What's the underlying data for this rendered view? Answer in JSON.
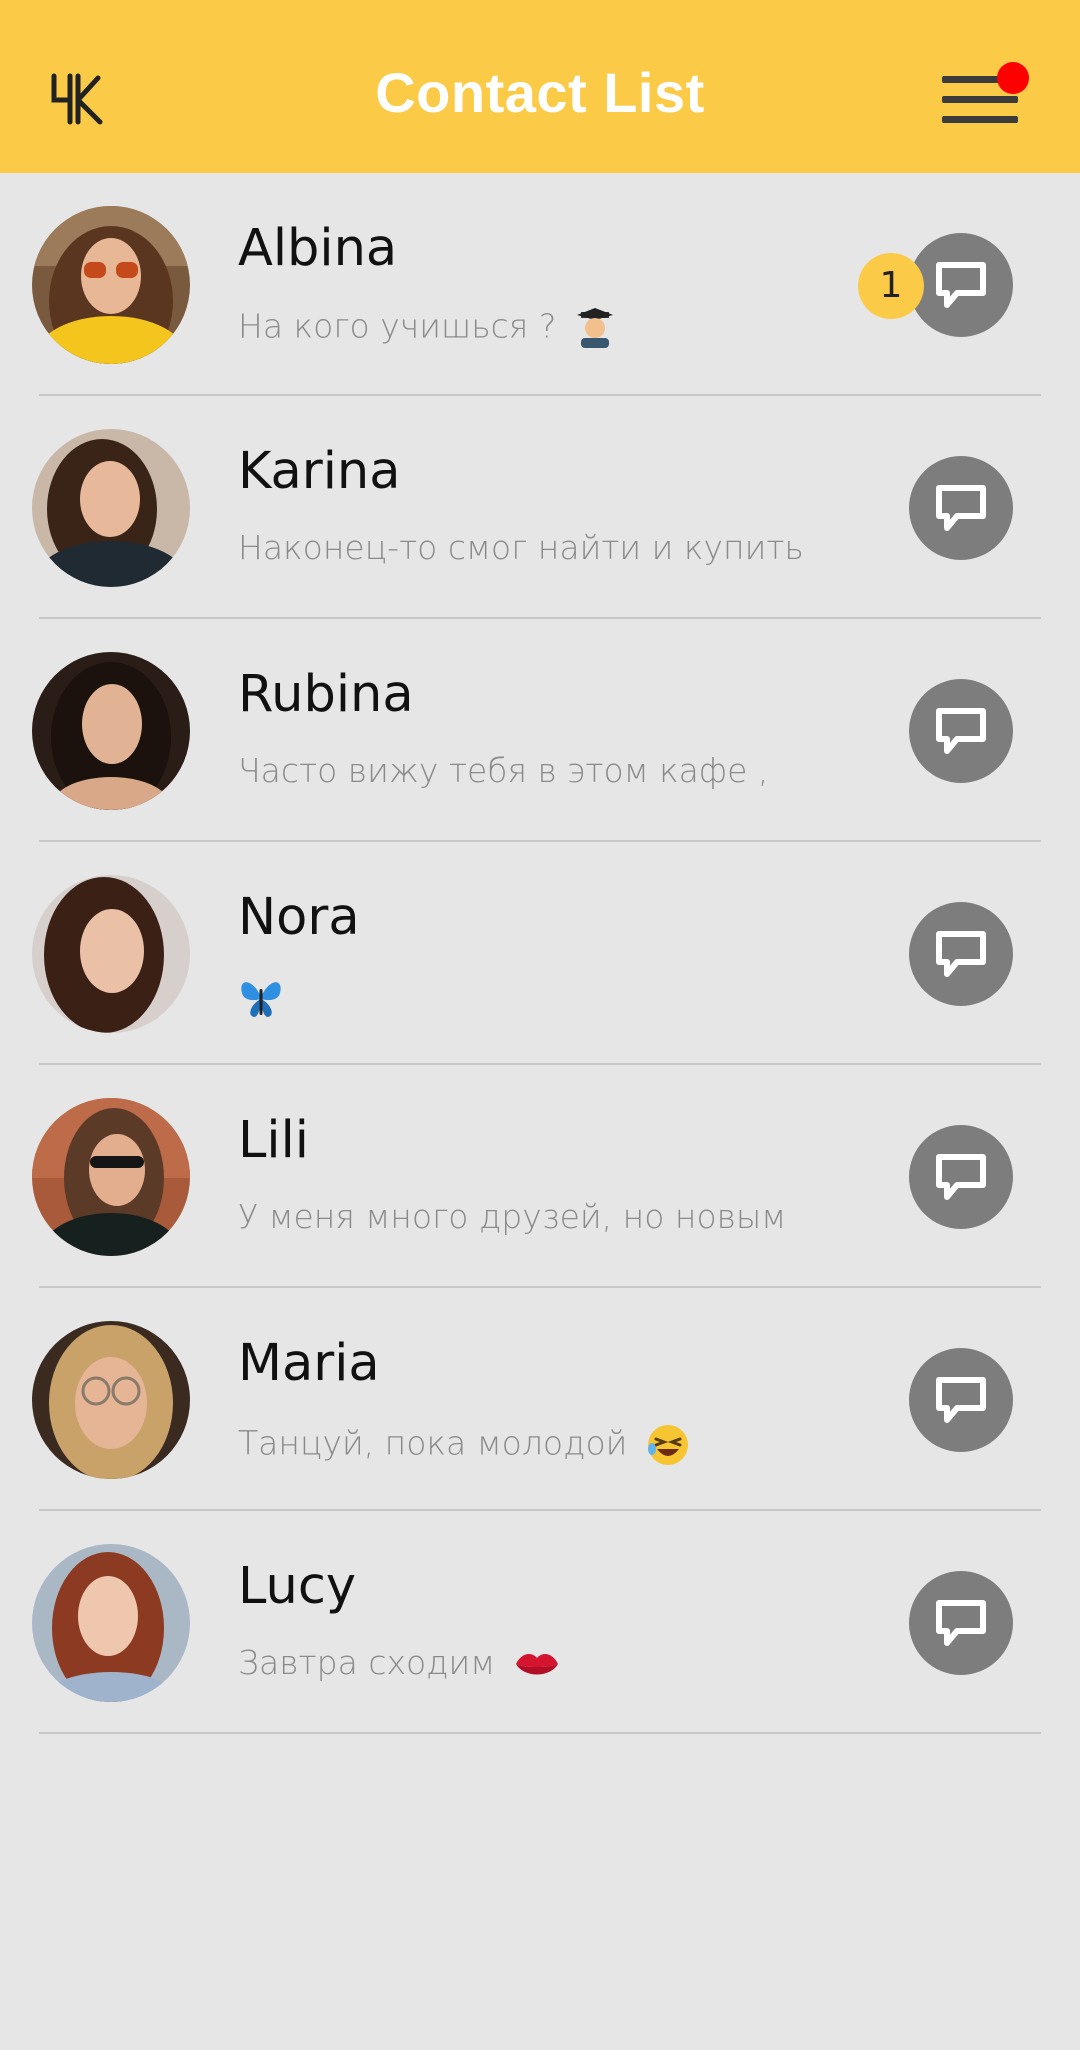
{
  "header": {
    "title": "Contact List",
    "logo_icon": "brand-logo-icon",
    "menu_icon": "hamburger-menu-icon",
    "notification_dot_color": "#ff0000",
    "background_color": "#fbca47"
  },
  "contacts": [
    {
      "name": "Albina",
      "message": "На кого учишься ?",
      "emoji": "student-emoji",
      "unread": "1"
    },
    {
      "name": "Karina",
      "message": "Наконец-то смог найти и купить",
      "emoji": "",
      "unread": ""
    },
    {
      "name": "Rubina",
      "message": "Часто вижу тебя в этом кафе ,",
      "emoji": "",
      "unread": ""
    },
    {
      "name": "Nora",
      "message": "",
      "emoji": "butterfly-emoji",
      "unread": ""
    },
    {
      "name": "Lili",
      "message": "У меня много друзей, но новым",
      "emoji": "",
      "unread": ""
    },
    {
      "name": "Maria",
      "message": "Танцуй, пока молодой",
      "emoji": "laughing-emoji",
      "unread": ""
    },
    {
      "name": "Lucy",
      "message": "Завтра сходим",
      "emoji": "kiss-lips-emoji",
      "unread": ""
    }
  ],
  "chat_button_icon": "chat-bubble-icon"
}
